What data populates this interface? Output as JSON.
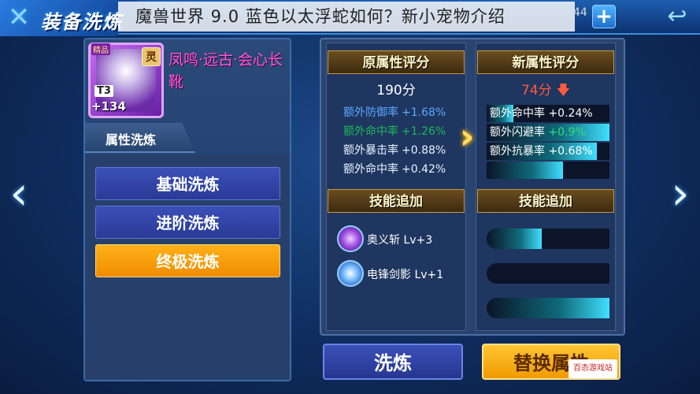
{
  "header": {
    "title": "装备洗炼",
    "caption": "魔兽世界 9.0 蓝色以太浮蛇如何？新小宠物介绍",
    "caption_tail": "44",
    "plus_icon": "plus-icon",
    "back_icon": "return-icon"
  },
  "item": {
    "quality_tag": "精品",
    "grade_tag": "T3",
    "enhance_level": "+134",
    "tier_badge": "灵",
    "name": "凤鸣·远古·会心长靴"
  },
  "left_panel": {
    "section_label": "属性洗炼",
    "buttons": [
      {
        "label": "基础洗炼",
        "active": false
      },
      {
        "label": "进阶洗炼",
        "active": false
      },
      {
        "label": "终极洗炼",
        "active": true
      }
    ]
  },
  "old_attrs": {
    "header": "原属性评分",
    "score": "190分",
    "stats": [
      {
        "name": "额外防御率",
        "value": "+1.68%",
        "color": "#5aa8ff"
      },
      {
        "name": "额外命中率",
        "value": "+1.26%",
        "color": "#1db85a"
      },
      {
        "name": "额外暴击率",
        "value": "+0.88%",
        "color": "#eaf2ff"
      },
      {
        "name": "额外命中率",
        "value": "+0.42%",
        "color": "#eaf2ff"
      }
    ]
  },
  "new_attrs": {
    "header": "新属性评分",
    "score": "74分",
    "score_trend": "down",
    "stats": [
      {
        "name": "额外命中率",
        "value": "+0.24%",
        "fill": 0.22
      },
      {
        "name": "额外闪避率",
        "value": "+0.9%",
        "fill": 1.0
      },
      {
        "name": "额外抗暴率",
        "value": "+0.68%",
        "fill": 0.9
      },
      {
        "name": "",
        "value": "",
        "fill": 0.62
      }
    ]
  },
  "skills_old": {
    "header": "技能追加",
    "items": [
      {
        "name": "奥义斩",
        "level": "Lv+3",
        "icon": "slash-skill-icon"
      },
      {
        "name": "电锋剑影",
        "level": "Lv+1",
        "icon": "lightning-sword-icon"
      }
    ]
  },
  "skills_new": {
    "header": "技能追加",
    "bars": [
      0.45,
      0.0,
      1.0
    ]
  },
  "actions": {
    "wash": "洗炼",
    "replace": "替换属性"
  },
  "watermark": "百态游戏站"
}
